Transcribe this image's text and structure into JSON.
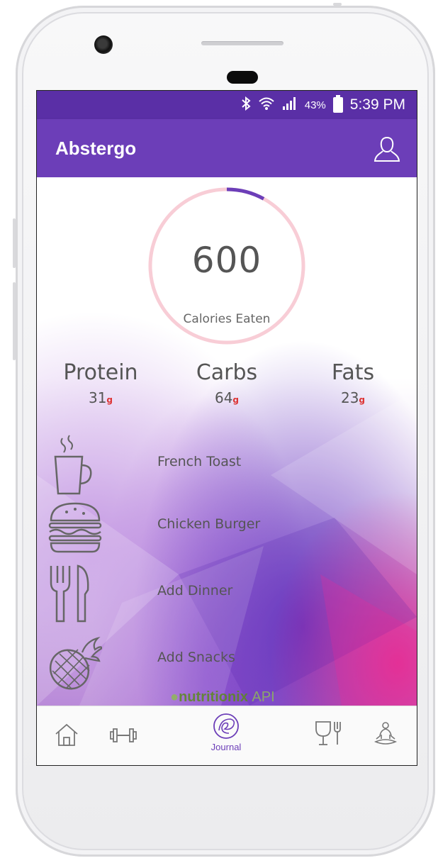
{
  "status_bar": {
    "bluetooth_icon": "bluetooth-icon",
    "wifi_icon": "wifi-icon",
    "signal_icon": "signal-icon",
    "battery_percent": "43%",
    "time": "5:39 PM"
  },
  "app_bar": {
    "title": "Abstergo",
    "profile_icon": "user-profile-icon"
  },
  "summary": {
    "calories": "600",
    "calories_label": "Calories Eaten",
    "progress_fraction": 0.08
  },
  "macros": [
    {
      "name": "Protein",
      "value": "31",
      "unit": "g"
    },
    {
      "name": "Carbs",
      "value": "64",
      "unit": "g"
    },
    {
      "name": "Fats",
      "value": "23",
      "unit": "g"
    }
  ],
  "meals": [
    {
      "icon": "coffee-cup-icon",
      "label": "French Toast"
    },
    {
      "icon": "burger-icon",
      "label": "Chicken Burger"
    },
    {
      "icon": "fork-knife-icon",
      "label": "Add Dinner"
    },
    {
      "icon": "pineapple-icon",
      "label": "Add Snacks"
    }
  ],
  "powered_by": {
    "brand": "nutritionix",
    "suffix": "API"
  },
  "bottom_nav": [
    {
      "icon": "home-icon",
      "label": ""
    },
    {
      "icon": "dumbbell-icon",
      "label": ""
    },
    {
      "icon": "journal-icon",
      "label": "Journal"
    },
    {
      "icon": "glass-fork-icon",
      "label": ""
    },
    {
      "icon": "meditation-icon",
      "label": ""
    }
  ],
  "colors": {
    "status_bar": "#5a2fa6",
    "app_bar": "#6c3eb8",
    "ring_track": "#f8cdd6",
    "ring_progress": "#6c3eb8",
    "macro_unit": "#dd3333"
  }
}
